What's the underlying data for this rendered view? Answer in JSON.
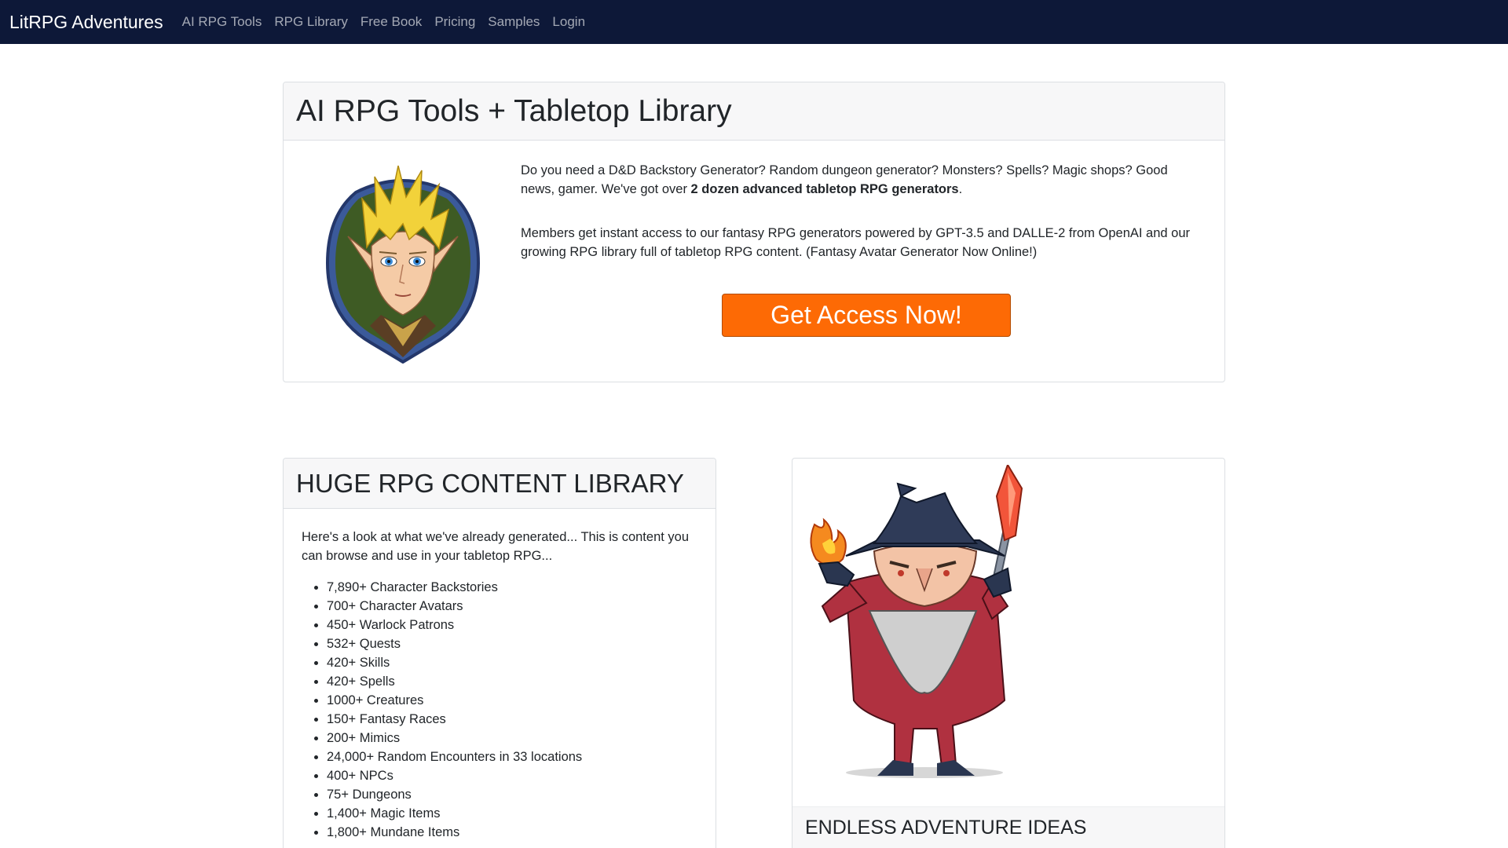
{
  "nav": {
    "brand": "LitRPG Adventures",
    "links": [
      "AI RPG Tools",
      "RPG Library",
      "Free Book",
      "Pricing",
      "Samples",
      "Login"
    ]
  },
  "hero": {
    "title": "AI RPG Tools + Tabletop Library",
    "para1_start": "Do you need a D&D Backstory Generator? Random dungeon generator? Monsters? Spells? Magic shops? Good news, gamer. We've got over ",
    "para1_bold": "2 dozen advanced tabletop RPG generators",
    "para1_end": ".",
    "para2": "Members get instant access to our fantasy RPG generators powered by GPT-3.5 and DALLE-2 from OpenAI and our growing RPG library full of tabletop RPG content. (Fantasy Avatar Generator Now Online!)",
    "cta_label": "Get Access Now!"
  },
  "library": {
    "title": "HUGE RPG CONTENT LIBRARY",
    "intro": "Here's a look at what we've already generated... This is content you can browse and use in your tabletop RPG...",
    "items": [
      "7,890+ Character Backstories",
      "700+ Character Avatars",
      "450+ Warlock Patrons",
      "532+ Quests",
      "420+ Skills",
      "420+ Spells",
      "1000+ Creatures",
      "150+ Fantasy Races",
      "200+ Mimics",
      "24,000+ Random Encounters in 33 locations",
      "400+ NPCs",
      "75+ Dungeons",
      "1,400+ Magic Items",
      "1,800+ Mundane Items"
    ]
  },
  "wizard_card": {
    "title": "ENDLESS ADVENTURE IDEAS"
  },
  "colors": {
    "navbar": "#0d1838",
    "cta": "#fd6a05",
    "card_header": "#f7f7f8"
  }
}
